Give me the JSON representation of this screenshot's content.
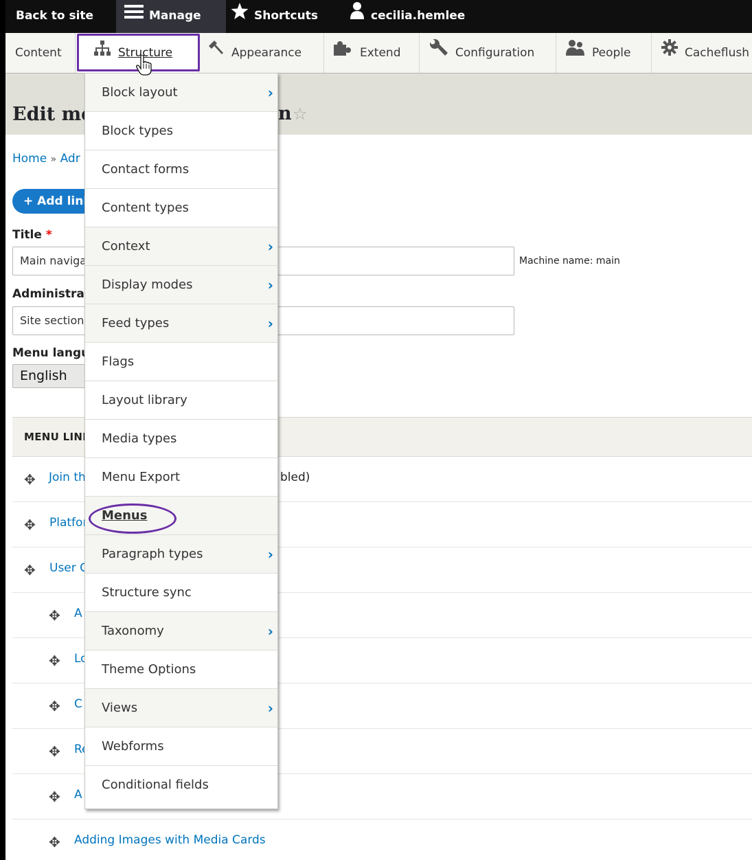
{
  "toolbar": {
    "back_label": "Back to site",
    "manage_label": "Manage",
    "shortcuts_label": "Shortcuts",
    "user_label": "cecilia.hemlee"
  },
  "tray": {
    "items": [
      {
        "label": "Content"
      },
      {
        "label": "Structure"
      },
      {
        "label": "Appearance"
      },
      {
        "label": "Extend"
      },
      {
        "label": "Configuration"
      },
      {
        "label": "People"
      },
      {
        "label": "Cacheflush"
      }
    ]
  },
  "page": {
    "title_left": "Edit me",
    "title_right": "n"
  },
  "breadcrumb": {
    "home": "Home",
    "separator": "»",
    "partial": "Adr"
  },
  "add_link_button": "+ Add link",
  "form": {
    "title_label": "Title",
    "required_mark": "*",
    "title_value": "Main navigation",
    "machine_name": "Machine name: main",
    "admin_label": "Administrative summary",
    "admin_value": "Site section links",
    "language_label": "Menu language",
    "language_value": "English"
  },
  "table": {
    "header": "MENU LINKS",
    "rows": [
      {
        "text": "Join the",
        "suffix": "bled)"
      },
      {
        "text": "Platform"
      },
      {
        "text": "User Guides"
      },
      {
        "text": "A"
      },
      {
        "text": "Lo"
      },
      {
        "text": "C"
      },
      {
        "text": "Re"
      },
      {
        "text": "A"
      },
      {
        "text": "Adding Images with Media Cards"
      }
    ]
  },
  "dropdown": {
    "items": [
      {
        "label": "Block layout",
        "has_children": true
      },
      {
        "label": "Block types",
        "has_children": false
      },
      {
        "label": "Contact forms",
        "has_children": false
      },
      {
        "label": "Content types",
        "has_children": false
      },
      {
        "label": "Context",
        "has_children": true
      },
      {
        "label": "Display modes",
        "has_children": true
      },
      {
        "label": "Feed types",
        "has_children": true
      },
      {
        "label": "Flags",
        "has_children": false
      },
      {
        "label": "Layout library",
        "has_children": false
      },
      {
        "label": "Media types",
        "has_children": false
      },
      {
        "label": "Menu Export",
        "has_children": false
      },
      {
        "label": "Menus",
        "has_children": false
      },
      {
        "label": "Paragraph types",
        "has_children": true
      },
      {
        "label": "Structure sync",
        "has_children": false
      },
      {
        "label": "Taxonomy",
        "has_children": true
      },
      {
        "label": "Theme Options",
        "has_children": false
      },
      {
        "label": "Views",
        "has_children": true
      },
      {
        "label": "Webforms",
        "has_children": false
      },
      {
        "label": "Conditional fields",
        "has_children": false
      }
    ]
  },
  "colors": {
    "accent_link": "#0074bd",
    "highlight": "#6a2fa5",
    "toolbar_bg": "#0f0f0f"
  }
}
